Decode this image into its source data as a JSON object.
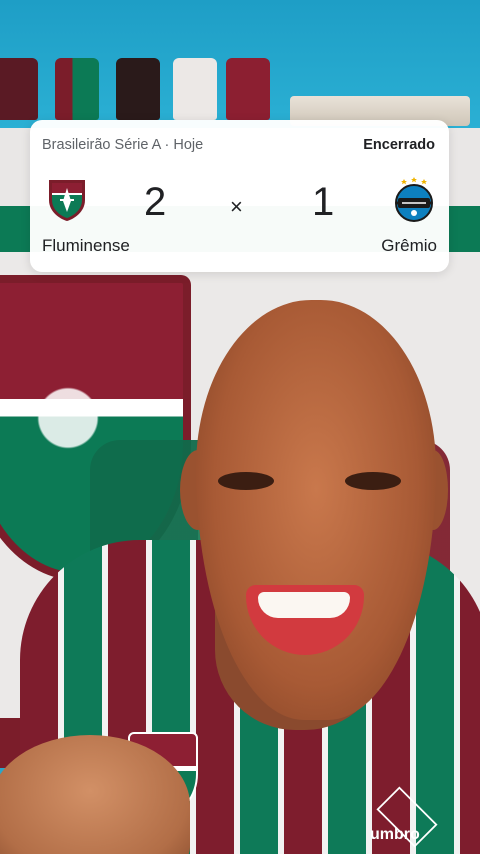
{
  "score_card": {
    "competition": "Brasileirão Série A · Hoje",
    "status": "Encerrado",
    "separator": "×",
    "home_team": {
      "name": "Fluminense",
      "score": "2",
      "crest_icon": "fluminense-crest-icon"
    },
    "away_team": {
      "name": "Grêmio",
      "score": "1",
      "crest_icon": "gremio-crest-icon"
    }
  },
  "background": {
    "description_colors": {
      "wall": "#2aa6c9",
      "fluminense_grena": "#7b1d2a",
      "fluminense_verde": "#0c7a55",
      "fluminense_branco": "#ebe9e8"
    }
  },
  "jersey_brand": "umbro"
}
